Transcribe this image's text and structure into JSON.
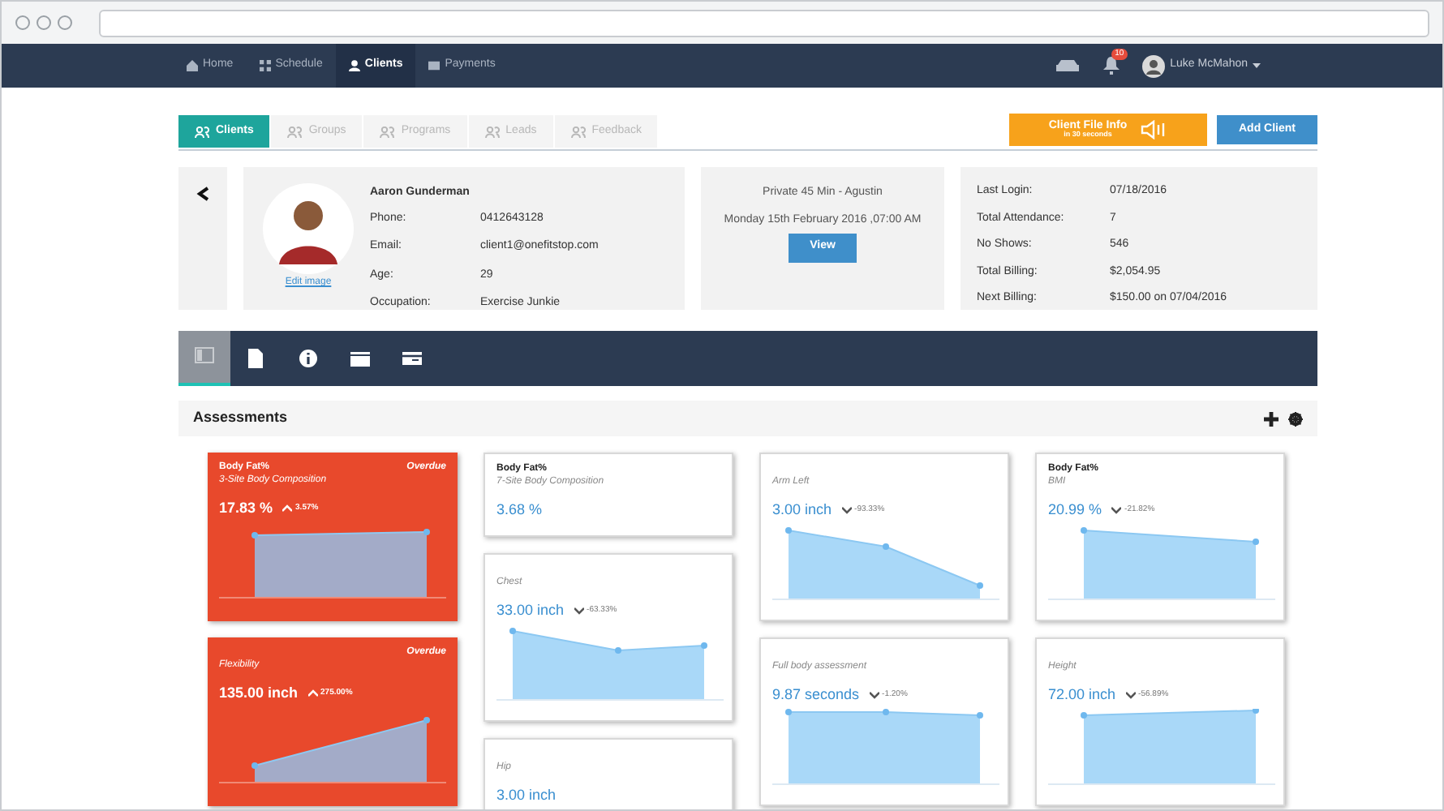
{
  "nav": {
    "items": [
      {
        "label": "Home",
        "selected": false
      },
      {
        "label": "Schedule",
        "selected": false
      },
      {
        "label": "Clients",
        "selected": true
      },
      {
        "label": "Payments",
        "selected": false
      }
    ],
    "notification_badge": "10",
    "user_name": "Luke McMahon"
  },
  "tabs": [
    {
      "label": "Clients",
      "selected": true
    },
    {
      "label": "Groups",
      "selected": false
    },
    {
      "label": "Programs",
      "selected": false
    },
    {
      "label": "Leads",
      "selected": false
    },
    {
      "label": "Feedback",
      "selected": false
    }
  ],
  "file_info_button": {
    "label": "Client File Info",
    "sublabel": "in 30 seconds"
  },
  "add_button": "Add Client",
  "client": {
    "name": "Aaron Gunderman",
    "edit_link": "Edit image",
    "fields": [
      {
        "label": "Phone:",
        "value": "0412643128"
      },
      {
        "label": "Email:",
        "value": "client1@onefitstop.com"
      },
      {
        "label": "Age:",
        "value": "29"
      },
      {
        "label": "Occupation:",
        "value": "Exercise Junkie"
      }
    ]
  },
  "appointment": {
    "title": "Private 45 Min - Agustin",
    "date": "Monday 15th February 2016 ,07:00 AM",
    "button": "View"
  },
  "stats": [
    {
      "label": "Last Login:",
      "value": "07/18/2016"
    },
    {
      "label": "Total Attendance:",
      "value": "7"
    },
    {
      "label": "No Shows:",
      "value": "546"
    },
    {
      "label": "Total Billing:",
      "value": "$2,054.95"
    },
    {
      "label": "Next Billing:",
      "value": "$150.00 on 07/04/2016"
    }
  ],
  "section_tabs": [
    {
      "selected": true
    },
    {
      "selected": false
    },
    {
      "selected": false
    },
    {
      "selected": false
    },
    {
      "selected": false
    }
  ],
  "assessments": {
    "title": "Assessments",
    "columns": [
      [
        {
          "kind": "overdue",
          "status": "Overdue",
          "title": "Body Fat%",
          "subtitle": "3-Site Body Composition",
          "value": "17.83 %",
          "rising": true,
          "change": "3.57%",
          "has_chart": true
        },
        {
          "kind": "overdue",
          "status": "Overdue",
          "subtitle": "Flexibility",
          "value": "135.00 inch",
          "rising": true,
          "change": "275.00%",
          "has_chart": true
        }
      ],
      [
        {
          "kind": "normal",
          "title": "Body Fat%",
          "subtitle": "7-Site Body Composition",
          "value": "3.68 %",
          "has_chart": false
        },
        {
          "kind": "normal",
          "subtitle": "Chest",
          "value": "33.00 inch",
          "rising": false,
          "change": "-63.33%",
          "has_chart": true
        },
        {
          "kind": "normal",
          "subtitle": "Hip",
          "value": "3.00 inch",
          "has_chart": false
        }
      ],
      [
        {
          "kind": "normal",
          "subtitle": "Arm Left",
          "value": "3.00 inch",
          "rising": false,
          "change": "-93.33%",
          "has_chart": true
        },
        {
          "kind": "normal",
          "subtitle": "Full body assessment",
          "value": "9.87 seconds",
          "rising": false,
          "change": "-1.20%",
          "has_chart": true
        }
      ],
      [
        {
          "kind": "normal",
          "title": "Body Fat%",
          "subtitle": "BMI",
          "value": "20.99 %",
          "rising": false,
          "change": "-21.82%",
          "has_chart": true
        },
        {
          "kind": "normal",
          "subtitle": "Height",
          "value": "72.00 inch",
          "rising": false,
          "change": "-56.89%",
          "has_chart": true
        }
      ]
    ]
  }
}
